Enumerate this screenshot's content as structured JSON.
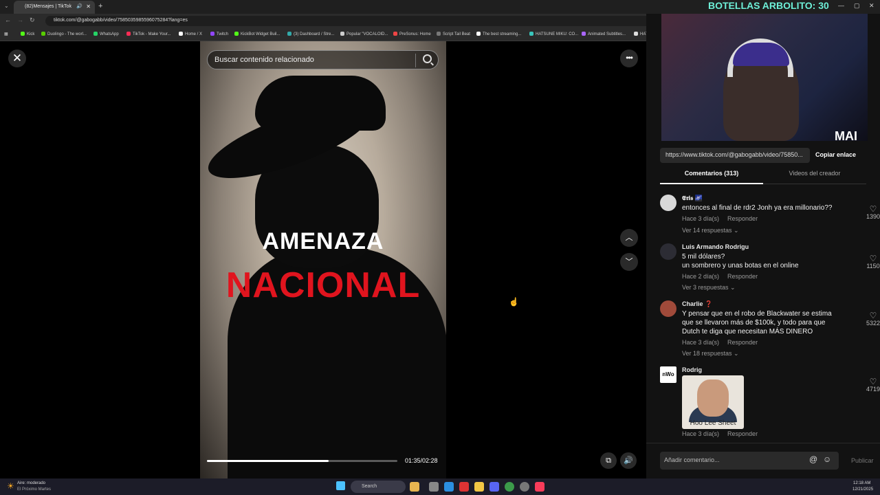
{
  "browser": {
    "tab_title": "(82)Mensajes | TikTok",
    "url": "tiktok.com/@gabogabb/video/7585035985596075284?lang=es",
    "bookmarks": [
      "Kick",
      "Duolingo - The worl...",
      "WhatsApp",
      "TikTok - Make Your...",
      "Home / X",
      "Twitch",
      "KickBot Widget Buil...",
      "(3) Dashboard / Stre...",
      "Popular \"VOCALOID...",
      "PreSonus: Home",
      "Script Tail Beat",
      "The best streaming...",
      "HATSUNE MIKU: CO...",
      "Animated Subtitles...",
      "HATSUNE"
    ]
  },
  "stream_overlay": {
    "title": "BOTELLAS ARBOLITO: 30",
    "logo": "MAI"
  },
  "video": {
    "search_placeholder": "Buscar contenido relacionado",
    "caption_line1": "AMENAZA",
    "caption_line2": "NACIONAL",
    "time": "01:35/02:28",
    "progress": 0.64
  },
  "panel": {
    "link": "https://www.tiktok.com/@gabogabb/video/75850...",
    "copy_label": "Copiar enlace",
    "tab_comments": "Comentarios (313)",
    "tab_creator": "Videos del creador",
    "comments": [
      {
        "name": "𝕰𝖗𝖎𝖘 🌌",
        "text": "entonces al final de rdr2 Jonh ya era millonario??",
        "time": "Hace 3 día(s)",
        "reply": "Responder",
        "replies": "Ver 14 respuestas ⌄",
        "likes": "1390"
      },
      {
        "name": "Luis Armando Rodrigu",
        "text": "5 mil dólares?\nun sombrero y unas botas en el online",
        "time": "Hace 2 día(s)",
        "reply": "Responder",
        "replies": "Ver 3 respuestas ⌄",
        "likes": "1150"
      },
      {
        "name": "Charlie ❓",
        "text": "Y pensar que en el robo de Blackwater se estima que se llevaron más de $100k, y todo para que Dutch te diga que necesitan MÁS DINERO",
        "time": "Hace 3 día(s)",
        "reply": "Responder",
        "replies": "Ver 18 respuestas ⌄",
        "likes": "5322"
      },
      {
        "name": "Rodrig",
        "sticker_caption": "Hoo Lee Sheet",
        "time": "Hace 3 día(s)",
        "reply": "Responder",
        "likes": "4719"
      }
    ],
    "comment_placeholder": "Añadir comentario...",
    "publish_label": "Publicar"
  },
  "taskbar": {
    "weather_title": "Aire: moderado",
    "weather_sub": "El Próximo Martes",
    "search_label": "Search",
    "clock_time": "12:18 AM",
    "clock_date": "12/21/2025"
  }
}
